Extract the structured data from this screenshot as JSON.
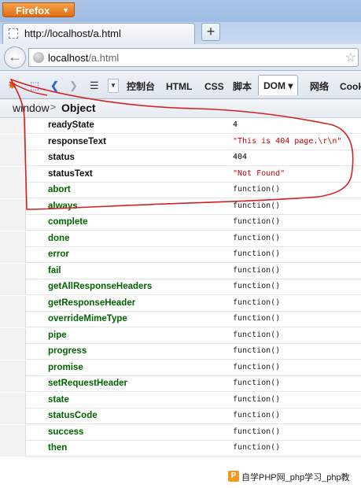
{
  "browser": {
    "app_button": "Firefox",
    "tab_title": "http://localhost/a.html",
    "new_tab": "+",
    "url_host": "localhost",
    "url_path": "/a.html"
  },
  "firebug": {
    "tabs": [
      "控制台",
      "HTML",
      "CSS",
      "脚本",
      "DOM ▾",
      "网络",
      "Cook"
    ],
    "active_tab": "DOM"
  },
  "breadcrumb": {
    "root": "window",
    "separator": ">",
    "current": "Object"
  },
  "rows": [
    {
      "name": "readyState",
      "value": "4",
      "kind": "num"
    },
    {
      "name": "responseText",
      "value": "\"This is 404 page.\\r\\n\"",
      "kind": "str"
    },
    {
      "name": "status",
      "value": "404",
      "kind": "num"
    },
    {
      "name": "statusText",
      "value": "\"Not Found\"",
      "kind": "str"
    },
    {
      "name": "abort",
      "value": "function()",
      "kind": "fn"
    },
    {
      "name": "always",
      "value": "function()",
      "kind": "fn"
    },
    {
      "name": "complete",
      "value": "function()",
      "kind": "fn"
    },
    {
      "name": "done",
      "value": "function()",
      "kind": "fn"
    },
    {
      "name": "error",
      "value": "function()",
      "kind": "fn"
    },
    {
      "name": "fail",
      "value": "function()",
      "kind": "fn"
    },
    {
      "name": "getAllResponseHeaders",
      "value": "function()",
      "kind": "fn"
    },
    {
      "name": "getResponseHeader",
      "value": "function()",
      "kind": "fn"
    },
    {
      "name": "overrideMimeType",
      "value": "function()",
      "kind": "fn"
    },
    {
      "name": "pipe",
      "value": "function()",
      "kind": "fn"
    },
    {
      "name": "progress",
      "value": "function()",
      "kind": "fn"
    },
    {
      "name": "promise",
      "value": "function()",
      "kind": "fn"
    },
    {
      "name": "setRequestHeader",
      "value": "function()",
      "kind": "fn"
    },
    {
      "name": "state",
      "value": "function()",
      "kind": "fn"
    },
    {
      "name": "statusCode",
      "value": "function()",
      "kind": "fn"
    },
    {
      "name": "success",
      "value": "function()",
      "kind": "fn"
    },
    {
      "name": "then",
      "value": "function()",
      "kind": "fn"
    }
  ],
  "watermark": {
    "logo": "P",
    "text": "自学PHP网_php学习_php教"
  },
  "colors": {
    "annotation": "#d42020",
    "function_name": "#006400",
    "string_value": "#cc0000"
  }
}
